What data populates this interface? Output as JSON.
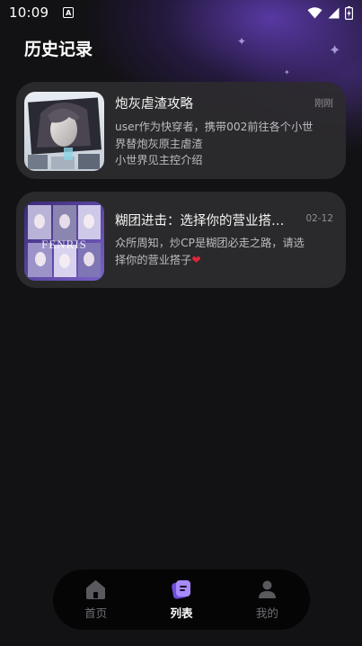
{
  "status_bar": {
    "time": "10:09",
    "notif_glyph": "A",
    "icons": [
      "wifi-icon",
      "signal-icon",
      "battery-icon"
    ]
  },
  "page": {
    "title": "历史记录"
  },
  "history": [
    {
      "title": "炮灰虐渣攻略",
      "time": "刚刚",
      "desc_line1": "user作为快穿者，携带002前往各个小世",
      "desc_line2": "界替炮灰原主虐渣",
      "desc_line3": "小世界见主控介绍"
    },
    {
      "title": "糊团进击：选择你的营业搭…",
      "time": "02-12",
      "desc_line1": "众所周知，炒CP是糊团必走之路，请选",
      "desc_line2": "择你的营业搭子",
      "desc_heart": "❤",
      "thumb_text": "FENRIS"
    }
  ],
  "nav": {
    "items": [
      {
        "label": "首页",
        "icon": "home-icon"
      },
      {
        "label": "列表",
        "icon": "list-icon"
      },
      {
        "label": "我的",
        "icon": "profile-icon"
      }
    ],
    "active_color": "#a78bfa"
  }
}
